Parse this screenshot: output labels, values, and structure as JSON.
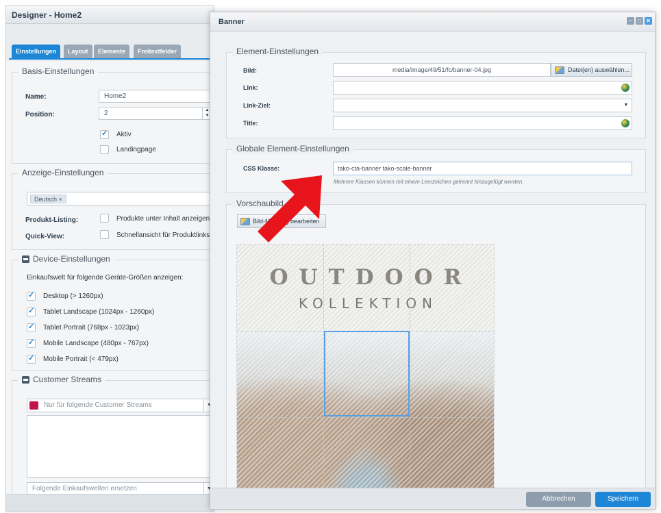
{
  "designer": {
    "title": "Designer - Home2",
    "tabs": [
      "Einstellungen",
      "Layout",
      "Elemente",
      "Freitextfelder"
    ],
    "basis": {
      "legend": "Basis-Einstellungen",
      "name_label": "Name:",
      "name_value": "Home2",
      "position_label": "Position:",
      "position_value": "2",
      "aktiv_label": "Aktiv",
      "landingpage_label": "Landingpage"
    },
    "anzeige": {
      "legend": "Anzeige-Einstellungen",
      "language_tag": "Deutsch",
      "produkt_listing_label": "Produkt-Listing:",
      "produkt_listing_text": "Produkte unter Inhalt anzeigen",
      "quick_view_label": "Quick-View:",
      "quick_view_text": "Schnellansicht für Produktlinks."
    },
    "device": {
      "legend": "Device-Einstellungen",
      "intro": "Einkaufswelt für folgende Geräte-Größen anzeigen:",
      "items": [
        "Desktop (> 1260px)",
        "Tablet Landscape (1024px - 1260px)",
        "Tablet Portrait (768px - 1023px)",
        "Mobile Landscape (480px - 767px)",
        "Mobile Portrait (< 479px)"
      ]
    },
    "streams": {
      "legend": "Customer Streams",
      "placeholder": "Nur für folgende Customer Streams",
      "replace_placeholder": "Folgende Einkaufswelten ersetzen"
    }
  },
  "modal": {
    "title": "Banner",
    "element": {
      "legend": "Element-Einstellungen",
      "bild_label": "Bild:",
      "bild_value": "media/image/49/51/fc/banner-04.jpg",
      "file_button": "Datei(en) auswählen...",
      "link_label": "Link:",
      "link_ziel_label": "Link-Ziel:",
      "title_label": "Title:"
    },
    "global": {
      "legend": "Globale Element-Einstellungen",
      "css_label": "CSS Klasse:",
      "css_value": "tako-cta-banner tako-scale-banner",
      "hint": "Mehrere Klassen können mit einem Leerzeichen getrennt hinzugefügt werden."
    },
    "vorschau": {
      "legend": "Vorschaubild",
      "media_button": "Bild-Mapping bearbeiten",
      "headline": "OUTDOOR",
      "subline": "KOLLEKTION"
    },
    "cancel_label": "Abbrechen",
    "save_label": "Speichern"
  },
  "colors": {
    "accent": "#1d86d6",
    "arrow": "#e8141b",
    "cancel": "#8d9dad"
  }
}
